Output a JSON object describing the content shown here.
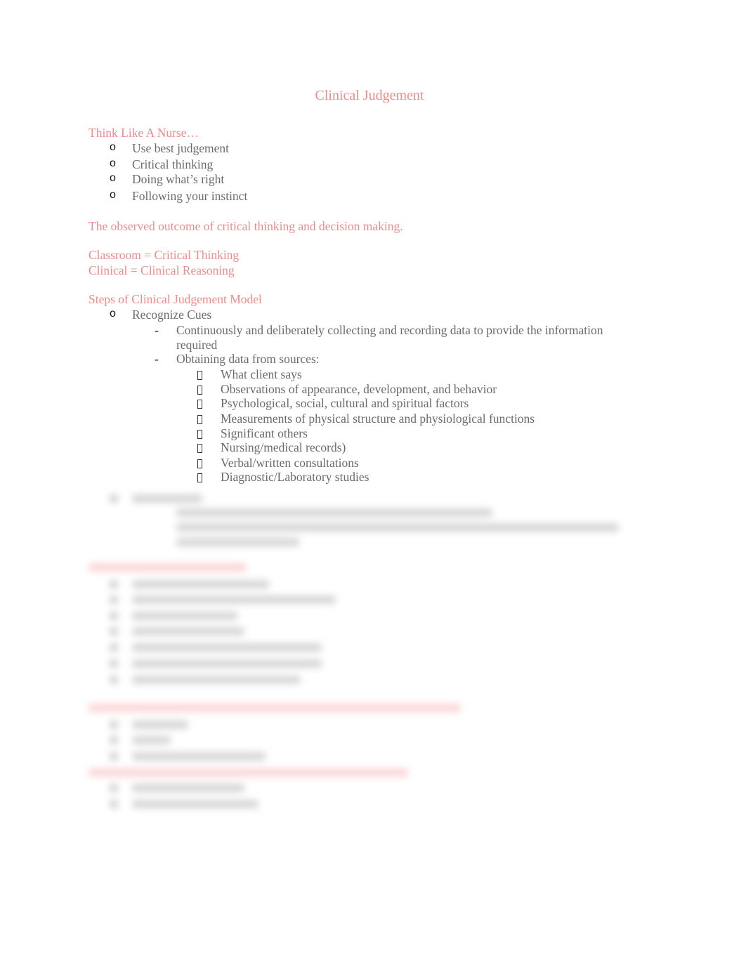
{
  "document": {
    "title": "Clinical Judgement",
    "sections": [
      {
        "heading": "Think Like A Nurse…",
        "items": [
          "Use best judgement",
          "Critical thinking",
          "Doing what’s right",
          "Following your instinct"
        ]
      },
      {
        "paragraph": "The observed outcome of critical thinking and decision making."
      },
      {
        "lines": [
          "Classroom = Critical Thinking",
          "Clinical = Clinical Reasoning"
        ]
      },
      {
        "heading": "Steps of Clinical Judgement Model",
        "steps": [
          {
            "label": "Recognize Cues",
            "sub": [
              {
                "text": "Continuously and deliberately collecting and recording data to provide the information",
                "cont": "required"
              },
              {
                "text": "Obtaining data from sources:",
                "sources": [
                  "What client says",
                  "Observations of appearance, development, and behavior",
                  "Psychological, social, cultural and spiritual factors",
                  "Measurements of physical structure and physiological functions",
                  "Significant others",
                  "Nursing/medical records)",
                  "Verbal/written consultations",
                  "Diagnostic/Laboratory studies"
                ]
              }
            ]
          }
        ]
      }
    ],
    "obscured_note": "Remaining content is blurred and unreadable"
  },
  "bullets": {
    "level1": "o",
    "level2": "-"
  }
}
